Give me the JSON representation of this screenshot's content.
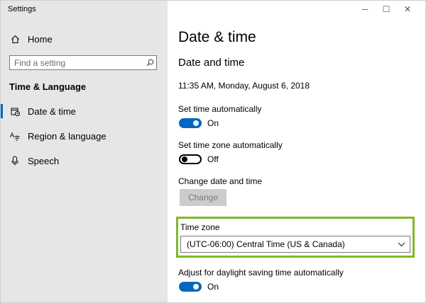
{
  "app": {
    "title": "Settings"
  },
  "window_controls": {
    "minimize": "─",
    "maximize": "☐",
    "close": "✕"
  },
  "sidebar": {
    "home_label": "Home",
    "search_placeholder": "Find a setting",
    "section_title": "Time & Language",
    "items": [
      {
        "label": "Date & time",
        "icon": "calendar-clock-icon",
        "active": true
      },
      {
        "label": "Region & language",
        "icon": "language-icon",
        "active": false
      },
      {
        "label": "Speech",
        "icon": "microphone-icon",
        "active": false
      }
    ]
  },
  "main": {
    "page_title": "Date & time",
    "section_title": "Date and time",
    "current_datetime": "11:35 AM, Monday, August 6, 2018",
    "set_time_auto": {
      "label": "Set time automatically",
      "state": "On"
    },
    "set_timezone_auto": {
      "label": "Set time zone automatically",
      "state": "Off"
    },
    "change_date": {
      "label": "Change date and time",
      "button": "Change"
    },
    "time_zone": {
      "label": "Time zone",
      "value": "(UTC-06:00) Central Time (US & Canada)"
    },
    "dst": {
      "label": "Adjust for daylight saving time automatically",
      "state": "On"
    }
  },
  "colors": {
    "accent": "#0067c0",
    "highlight": "#7fba2a",
    "sidebar_bg": "#e6e6e6"
  }
}
